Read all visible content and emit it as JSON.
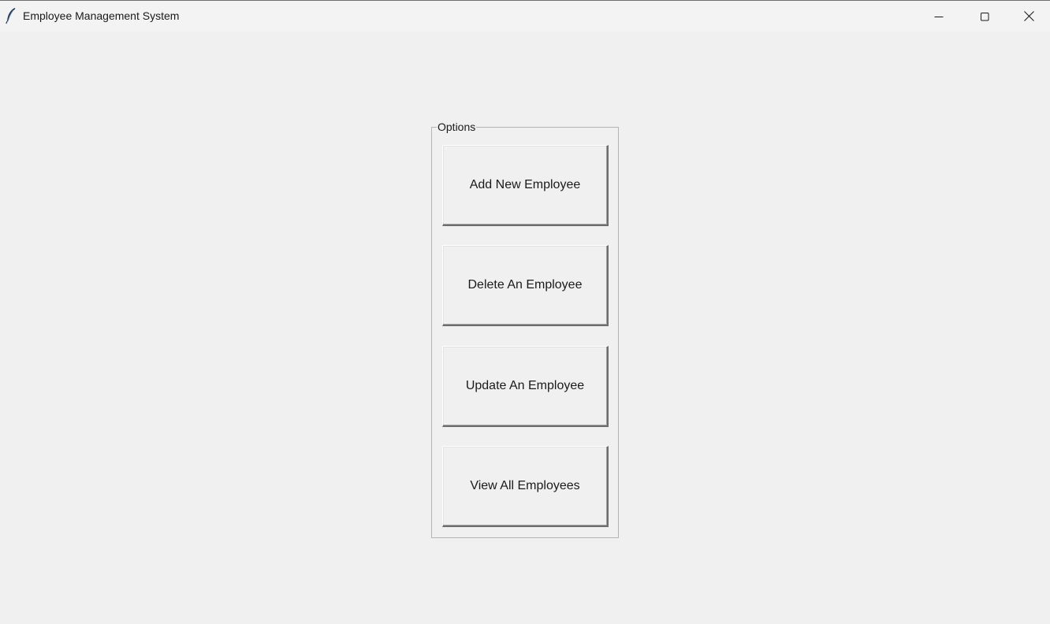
{
  "window": {
    "title": "Employee Management System",
    "controls": {
      "minimize_icon": "minimize-icon",
      "maximize_icon": "maximize-icon",
      "close_icon": "close-icon"
    }
  },
  "options": {
    "legend": "Options",
    "buttons": [
      {
        "label": "Add New Employee"
      },
      {
        "label": "Delete An Employee"
      },
      {
        "label": "Update An Employee"
      },
      {
        "label": "View All Employees"
      }
    ]
  },
  "colors": {
    "background": "#f0f0f0",
    "titlebar": "#f3f3f3",
    "text": "#1a1a1a",
    "frame_border": "#b4b4b4"
  }
}
